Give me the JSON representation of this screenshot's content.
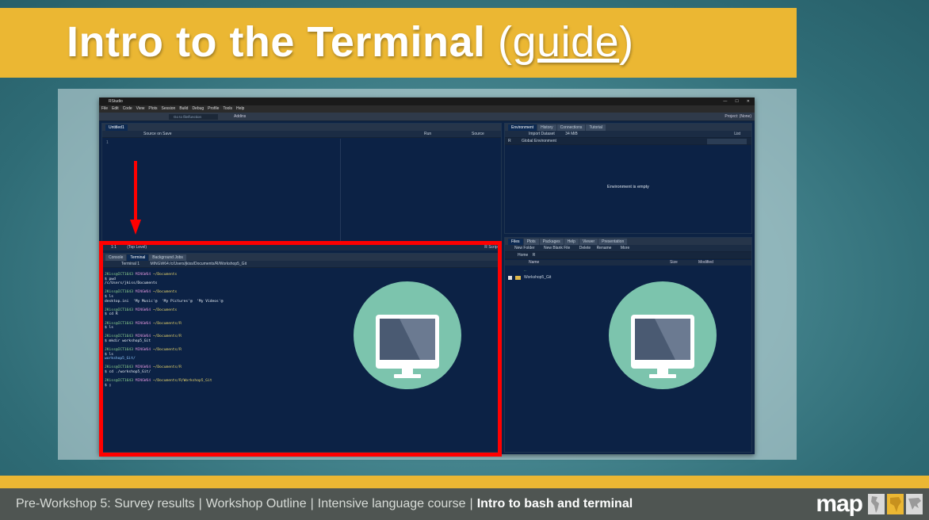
{
  "slide": {
    "title_main": "Intro to the Terminal",
    "title_open": "(",
    "title_link": "guide",
    "title_close": ")"
  },
  "rstudio": {
    "window_title": "RStudio",
    "window_controls": [
      "—",
      "☐",
      "✕"
    ],
    "menu": [
      "File",
      "Edit",
      "Code",
      "View",
      "Plots",
      "Session",
      "Build",
      "Debug",
      "Profile",
      "Tools",
      "Help"
    ],
    "goto_placeholder": "Go to file/function",
    "addins_label": "Addins",
    "project_label": "Project: (None)",
    "editor": {
      "tab": "Untitled1",
      "source_on_save": "Source on Save",
      "run": "Run",
      "source": "Source",
      "line_number": "1",
      "status_pos": "1:1",
      "status_level": "(Top Level)",
      "status_type": "R Script"
    },
    "console": {
      "tabs": [
        "Console",
        "Terminal",
        "Background Jobs"
      ],
      "active_tab": "Terminal",
      "terminal_selector": "Terminal 1",
      "path": "MINGW64:/c/Users/jkiss/Documents/R/Workshop5_Git",
      "lines": [
        {
          "user": "JKiss@ICT1643",
          "sys": "MINGW64",
          "dir": "~/Documents"
        },
        {
          "cmd": "$ pwd"
        },
        {
          "out": "/c/Users/jkiss/Documents"
        },
        {
          "blank": true
        },
        {
          "user": "JKiss@ICT1643",
          "sys": "MINGW64",
          "dir": "~/Documents"
        },
        {
          "cmd": "$ ls"
        },
        {
          "out": "desktop.ini  'My Music'@  'My Pictures'@  'My Videos'@"
        },
        {
          "blank": true
        },
        {
          "user": "JKiss@ICT1643",
          "sys": "MINGW64",
          "dir": "~/Documents"
        },
        {
          "cmd": "$ cd R"
        },
        {
          "blank": true
        },
        {
          "user": "JKiss@ICT1643",
          "sys": "MINGW64",
          "dir": "~/Documents/R"
        },
        {
          "cmd": "$ ls"
        },
        {
          "blank": true
        },
        {
          "user": "JKiss@ICT1643",
          "sys": "MINGW64",
          "dir": "~/Documents/R"
        },
        {
          "cmd": "$ mkdir workshop5_Git"
        },
        {
          "blank": true
        },
        {
          "user": "JKiss@ICT1643",
          "sys": "MINGW64",
          "dir": "~/Documents/R"
        },
        {
          "cmd": "$ ls"
        },
        {
          "out_dir": "workshop5_Git/"
        },
        {
          "blank": true
        },
        {
          "user": "JKiss@ICT1643",
          "sys": "MINGW64",
          "dir": "~/Documents/R"
        },
        {
          "cmd": "$ cd ./workshop5_Git/"
        },
        {
          "blank": true
        },
        {
          "user": "JKiss@ICT1643",
          "sys": "MINGW64",
          "dir": "~/Documents/R/Workshop5_Git"
        },
        {
          "cmd": "$ ▯"
        }
      ]
    },
    "environment": {
      "tabs": [
        "Environment",
        "History",
        "Connections",
        "Tutorial"
      ],
      "import_dataset": "Import Dataset",
      "memory": "34 MiB",
      "view_mode": "List",
      "r_label": "R",
      "scope": "Global Environment",
      "empty_message": "Environment is empty"
    },
    "files": {
      "tabs": [
        "Files",
        "Plots",
        "Packages",
        "Help",
        "Viewer",
        "Presentation"
      ],
      "new_folder": "New Folder",
      "new_blank_file": "New Blank File",
      "delete": "Delete",
      "rename": "Rename",
      "more": "More",
      "breadcrumb_home": "Home",
      "breadcrumb_r": "R",
      "col_name": "Name",
      "col_size": "Size",
      "col_modified": "Modified",
      "parent_entry": "..",
      "folder_entry": "Workshop5_Git"
    }
  },
  "footer": {
    "items": [
      "Pre-Workshop 5: Survey results",
      "Workshop Outline",
      "Intensive language course"
    ],
    "separator": "|",
    "current": "Intro to bash and terminal",
    "logo_word": "map"
  },
  "colors": {
    "accent_yellow": "#ebb733",
    "teal_background": "#3f7e87",
    "footer_gray": "#4f5552",
    "highlight_red": "#ff0000",
    "icon_circle": "#7cc4ad",
    "rstudio_bg": "#0d2344"
  },
  "icons": [
    "monitor-icon",
    "down-arrow-icon",
    "folder-icon",
    "home-icon"
  ]
}
